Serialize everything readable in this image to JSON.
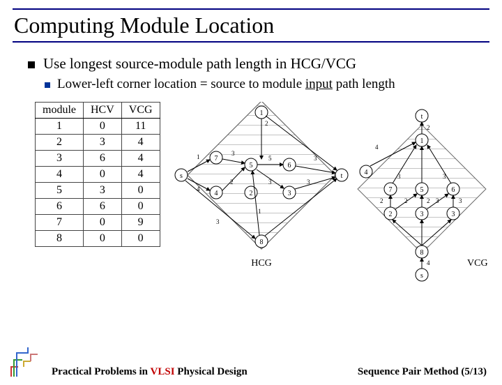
{
  "title": "Computing Module Location",
  "bullet1": "Use longest source-module path length in HCG/VCG",
  "sub1_pre": "Lower-left corner location = source to module ",
  "sub1_underlined": "input",
  "sub1_post": " path length",
  "table": {
    "headers": [
      "module",
      "HCV",
      "VCG"
    ],
    "rows": [
      [
        "1",
        "0",
        "11"
      ],
      [
        "2",
        "3",
        "4"
      ],
      [
        "3",
        "6",
        "4"
      ],
      [
        "4",
        "0",
        "4"
      ],
      [
        "5",
        "3",
        "0"
      ],
      [
        "6",
        "6",
        "0"
      ],
      [
        "7",
        "0",
        "9"
      ],
      [
        "8",
        "0",
        "0"
      ]
    ]
  },
  "hcg": {
    "label": "HCG",
    "nodes": {
      "s": "s",
      "t": "t",
      "n1": "1",
      "n2": "2",
      "n3": "3",
      "n4": "4",
      "n5": "5",
      "n6": "6",
      "n7": "7",
      "n8": "8"
    },
    "edge_labels": {
      "s7": "1",
      "s4": "4",
      "s8": "3",
      "n12": "2",
      "n75": "3",
      "n45": "2",
      "n85": "1",
      "n53": "5",
      "n56": "3",
      "n63": "3",
      "n6t": "3"
    }
  },
  "vcg": {
    "label": "VCG",
    "nodes": {
      "s": "s",
      "t": "t",
      "n1": "1",
      "n2": "2",
      "n3": "3",
      "n4": "4",
      "n5": "5",
      "n6": "6",
      "n7": "7",
      "n8": "8"
    },
    "edge_labels": {
      "s8": "4",
      "n41": "4",
      "n1t": "2",
      "n27": "2",
      "n25": "2",
      "n74": "3",
      "n54": "2",
      "n53": "3",
      "n63": "3",
      "n36": "3"
    }
  },
  "footer_left_pre": "Practical Problems in ",
  "footer_left_vlsi": "VLSI",
  "footer_left_post": " Physical Design",
  "footer_right": "Sequence Pair Method (5/13)"
}
